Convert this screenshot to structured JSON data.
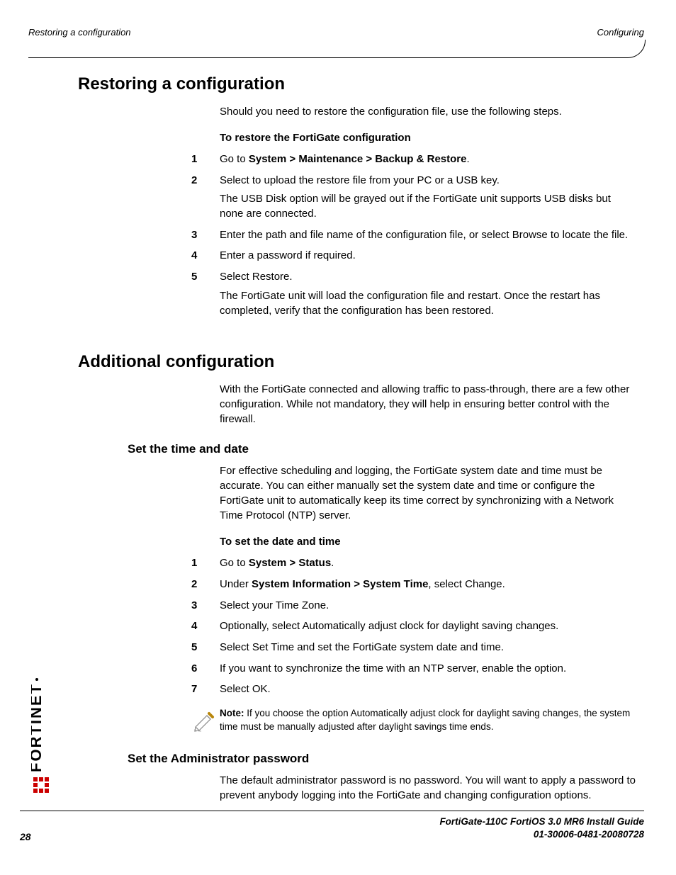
{
  "header": {
    "left": "Restoring a configuration",
    "right": "Configuring"
  },
  "section1": {
    "title": "Restoring a configuration",
    "intro": "Should you need to restore the configuration file, use the following steps.",
    "subhead": "To restore the FortiGate configuration",
    "steps": {
      "s1_prefix": "Go to ",
      "s1_bold": "System > Maintenance > Backup & Restore",
      "s1_suffix": ".",
      "s2": "Select to upload the restore file from your PC or a USB key.",
      "s2_para": "The USB Disk option will be grayed out if the FortiGate unit supports USB disks but none are connected.",
      "s3": "Enter the path and file name of the configuration file, or select Browse to locate the file.",
      "s4": "Enter a password if required.",
      "s5": "Select Restore.",
      "s5_para": "The FortiGate unit will load the configuration file and restart. Once the restart has completed, verify that the configuration has been restored."
    }
  },
  "section2": {
    "title": "Additional configuration",
    "intro": "With the FortiGate connected and allowing traffic to pass-through, there are a few other configuration. While not mandatory, they will help in ensuring better control with the firewall.",
    "sub1": {
      "title": "Set the time and date",
      "intro": "For effective scheduling and logging, the FortiGate system date and time must be accurate. You can either manually set the system date and time or configure the FortiGate unit to automatically keep its time correct by synchronizing with a Network Time Protocol (NTP) server.",
      "subhead": "To set the date and time",
      "steps": {
        "s1_prefix": "Go to ",
        "s1_bold": "System > Status",
        "s1_suffix": ".",
        "s2_prefix": "Under ",
        "s2_bold": "System Information > System Time",
        "s2_suffix": ", select Change.",
        "s3": "Select your Time Zone.",
        "s4": "Optionally, select Automatically adjust clock for daylight saving changes.",
        "s5": "Select Set Time and set the FortiGate system date and time.",
        "s6": "If you want to synchronize the time with an NTP server, enable the option.",
        "s7": "Select OK."
      },
      "note_label": "Note:",
      "note_text": " If you choose the option Automatically adjust clock for daylight saving changes, the system time must be manually adjusted after daylight savings time ends."
    },
    "sub2": {
      "title": "Set the Administrator password",
      "intro": "The default administrator password is no password. You will want to apply a password to prevent anybody logging into the FortiGate and changing configuration options."
    }
  },
  "footer": {
    "line1": "FortiGate-110C FortiOS 3.0 MR6 Install Guide",
    "line2": "01-30006-0481-20080728",
    "page": "28"
  },
  "logo_text": "FORTINET"
}
